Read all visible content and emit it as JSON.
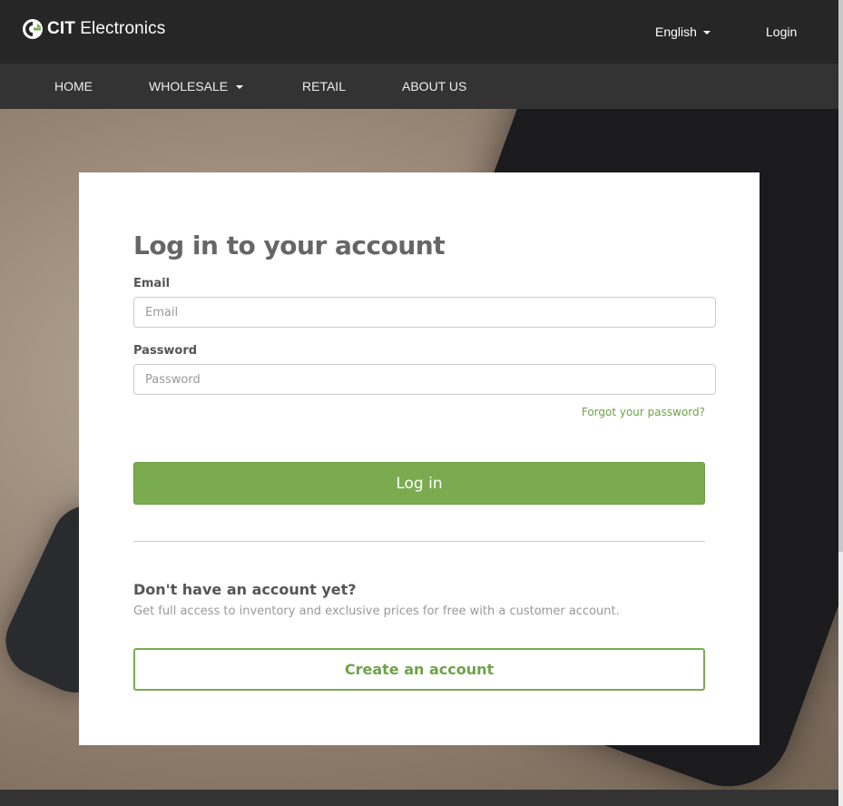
{
  "brand": {
    "logo_bold": "CIT",
    "logo_rest": " Electronics",
    "icon": "cit-logo-icon",
    "accent": "#7aab4f"
  },
  "header": {
    "language": "English",
    "login": "Login"
  },
  "nav": {
    "home": "HOME",
    "wholesale": "WHOLESALE",
    "retail": "RETAIL",
    "about": "ABOUT US"
  },
  "login_form": {
    "title": "Log in to your account",
    "email_label": "Email",
    "email_placeholder": "Email",
    "password_label": "Password",
    "password_placeholder": "Password",
    "forgot": "Forgot your password?",
    "submit": "Log in"
  },
  "signup": {
    "question": "Don't have an account yet?",
    "description": "Get full access to inventory and exclusive prices for free with a customer account.",
    "button": "Create an account"
  }
}
